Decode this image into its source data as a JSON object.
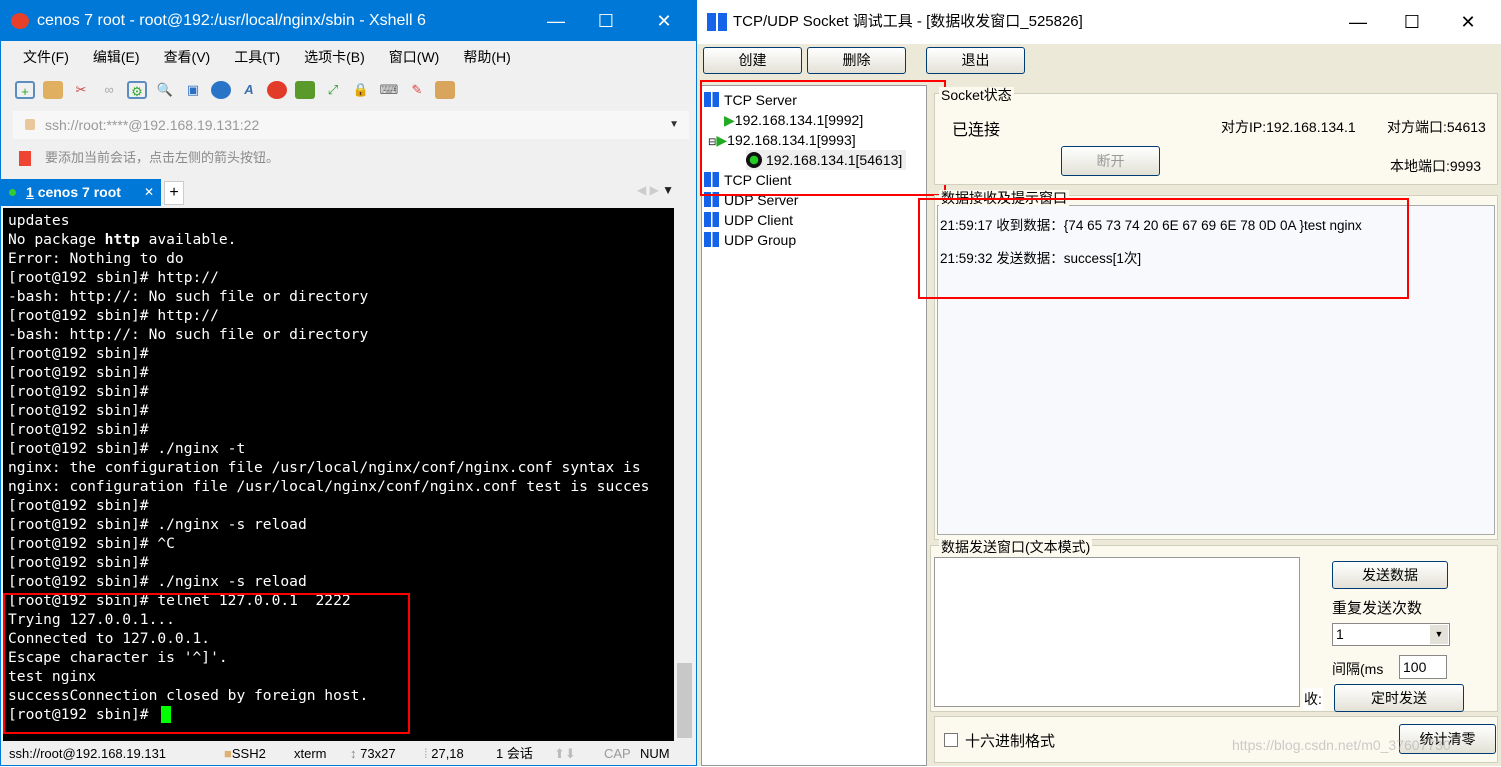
{
  "xshell": {
    "title": "cenos 7 root - root@192:/usr/local/nginx/sbin - Xshell 6",
    "menu": [
      "文件(F)",
      "编辑(E)",
      "查看(V)",
      "工具(T)",
      "选项卡(B)",
      "窗口(W)",
      "帮助(H)"
    ],
    "address": "ssh://root:****@192.168.19.131:22",
    "hint": "要添加当前会话，点击左侧的箭头按钮。",
    "tab": {
      "number": "1",
      "label": "cenos 7 root"
    },
    "terminal_lines": [
      "updates",
      "No package http available.",
      "Error: Nothing to do",
      "[root@192 sbin]# http://",
      "-bash: http://: No such file or directory",
      "[root@192 sbin]# http://",
      "-bash: http://: No such file or directory",
      "[root@192 sbin]#",
      "[root@192 sbin]#",
      "[root@192 sbin]#",
      "[root@192 sbin]#",
      "[root@192 sbin]#",
      "[root@192 sbin]# ./nginx -t",
      "nginx: the configuration file /usr/local/nginx/conf/nginx.conf syntax is",
      "nginx: configuration file /usr/local/nginx/conf/nginx.conf test is succes",
      "[root@192 sbin]#",
      "[root@192 sbin]# ./nginx -s reload",
      "[root@192 sbin]# ^C",
      "[root@192 sbin]#",
      "[root@192 sbin]# ./nginx -s reload",
      "[root@192 sbin]# telnet 127.0.0.1  2222",
      "Trying 127.0.0.1...",
      "Connected to 127.0.0.1.",
      "Escape character is '^]'.",
      "test nginx",
      "successConnection closed by foreign host.",
      "[root@192 sbin]# "
    ],
    "status": {
      "conn": "ssh://root@192.168.19.131",
      "proto": "SSH2",
      "term": "xterm",
      "size": "73x27",
      "pos": "27,18",
      "sessions": "1 会话",
      "cap": "CAP",
      "num": "NUM"
    }
  },
  "socket": {
    "title": "TCP/UDP Socket 调试工具 - [数据收发窗口_525826]",
    "toolbar": {
      "create": "创建",
      "delete": "删除",
      "exit": "退出"
    },
    "tree": {
      "tcp_server": "TCP Server",
      "s1": "192.168.134.1[9992]",
      "s2": "192.168.134.1[9993]",
      "c1": "192.168.134.1[54613]",
      "tcp_client": "TCP Client",
      "udp_server": "UDP Server",
      "udp_client": "UDP Client",
      "udp_group": "UDP Group"
    },
    "status_group": {
      "legend": "Socket状态",
      "state": "已连接",
      "remote_ip": "对方IP:192.168.134.1",
      "remote_port": "对方端口:54613",
      "local_port": "本地端口:9993",
      "disconnect": "断开"
    },
    "recv_group": {
      "legend": "数据接收及提示窗口",
      "lines": [
        "21:59:17 收到数据：{74 65 73 74 20 6E 67 69 6E 78 0D 0A }test nginx",
        "21:59:32 发送数据：success[1次]"
      ]
    },
    "send_group": {
      "legend": "数据发送窗口(文本模式)",
      "send": "发送数据",
      "repeat_label": "重复发送次数",
      "repeat_value": "1",
      "interval_label": "间隔(ms",
      "interval_value": "100",
      "recv_label": "收:",
      "timer_send": "定时发送"
    },
    "hex_label": "十六进制格式",
    "hex_checked": false,
    "clear_stats": "统计清零",
    "watermark": "https://blog.csdn.net/m0_37607730"
  }
}
